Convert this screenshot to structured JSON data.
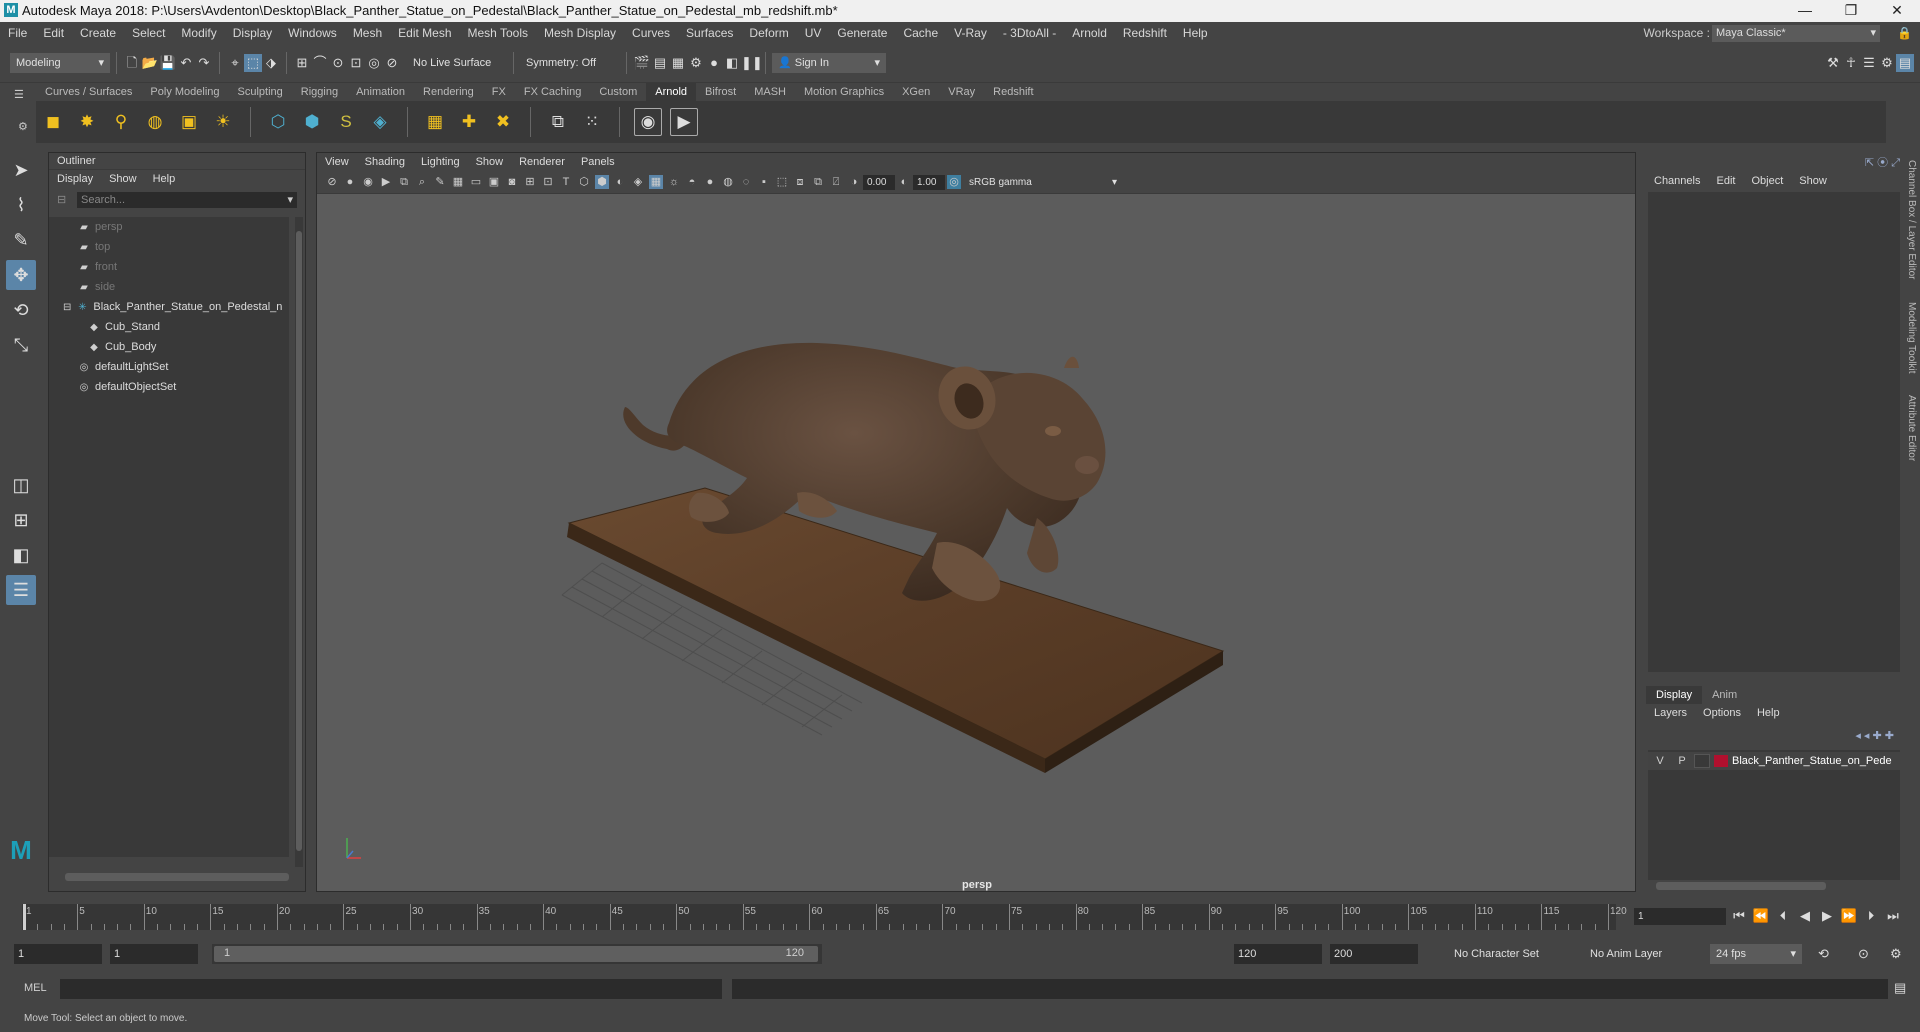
{
  "window": {
    "title": "Autodesk Maya 2018: P:\\Users\\Avdenton\\Desktop\\Black_Panther_Statue_on_Pedestal\\Black_Panther_Statue_on_Pedestal_mb_redshift.mb*",
    "logo": "M",
    "minimize": "—",
    "maximize": "❐",
    "close": "✕"
  },
  "menubar": {
    "items": [
      "File",
      "Edit",
      "Create",
      "Select",
      "Modify",
      "Display",
      "Windows",
      "Mesh",
      "Edit Mesh",
      "Mesh Tools",
      "Mesh Display",
      "Curves",
      "Surfaces",
      "Deform",
      "UV",
      "Generate",
      "Cache",
      "V-Ray",
      "- 3DtoAll -",
      "Arnold",
      "Redshift",
      "Help"
    ],
    "workspace_label": "Workspace :",
    "workspace_value": "Maya Classic*"
  },
  "statusline": {
    "mode": "Modeling",
    "live_surface": "No Live Surface",
    "symmetry": "Symmetry: Off",
    "sign_in": "Sign In"
  },
  "shelf": {
    "tabs": [
      "Curves / Surfaces",
      "Poly Modeling",
      "Sculpting",
      "Rigging",
      "Animation",
      "Rendering",
      "FX",
      "FX Caching",
      "Custom",
      "Arnold",
      "Bifrost",
      "MASH",
      "Motion Graphics",
      "XGen",
      "VRay",
      "Redshift"
    ],
    "active_tab": "Arnold"
  },
  "outliner": {
    "title": "Outliner",
    "menu": [
      "Display",
      "Show",
      "Help"
    ],
    "search_placeholder": "Search...",
    "items": [
      {
        "label": "persp",
        "dim": true,
        "indent": 1
      },
      {
        "label": "top",
        "dim": true,
        "indent": 1
      },
      {
        "label": "front",
        "dim": true,
        "indent": 1
      },
      {
        "label": "side",
        "dim": true,
        "indent": 1
      },
      {
        "label": "Black_Panther_Statue_on_Pedestal_n",
        "dim": false,
        "indent": 0
      },
      {
        "label": "Cub_Stand",
        "dim": false,
        "indent": 2
      },
      {
        "label": "Cub_Body",
        "dim": false,
        "indent": 2
      },
      {
        "label": "defaultLightSet",
        "dim": false,
        "indent": 1
      },
      {
        "label": "defaultObjectSet",
        "dim": false,
        "indent": 1
      }
    ]
  },
  "viewport": {
    "menu": [
      "View",
      "Shading",
      "Lighting",
      "Show",
      "Renderer",
      "Panels"
    ],
    "exposure": "0.00",
    "gamma": "1.00",
    "color_space": "sRGB gamma",
    "camera_label": "persp"
  },
  "channelbox": {
    "menu": [
      "Channels",
      "Edit",
      "Object",
      "Show"
    ],
    "vertical_tabs": [
      "Channel Box / Layer Editor",
      "Modeling Toolkit",
      "Attribute Editor"
    ]
  },
  "layereditor": {
    "tabs": [
      "Display",
      "Anim"
    ],
    "active_tab": "Display",
    "menu": [
      "Layers",
      "Options",
      "Help"
    ],
    "layer": {
      "v": "V",
      "p": "P",
      "name": "Black_Panther_Statue_on_Pede",
      "color": "#b0102e"
    }
  },
  "timeline": {
    "ticks": [
      1,
      5,
      10,
      15,
      20,
      25,
      30,
      35,
      40,
      45,
      50,
      55,
      60,
      65,
      70,
      75,
      80,
      85,
      90,
      95,
      100,
      105,
      110,
      115,
      120
    ],
    "current_frame": "1",
    "min": 1,
    "max": 120
  },
  "range": {
    "start": "1",
    "playback_start": "1",
    "slider_start": "1",
    "slider_end": "120",
    "playback_end": "120",
    "end": "200",
    "character_set": "No Character Set",
    "anim_layer": "No Anim Layer",
    "fps": "24 fps"
  },
  "cmdline": {
    "label": "MEL"
  },
  "helpline": {
    "text": "Move Tool: Select an object to move."
  }
}
